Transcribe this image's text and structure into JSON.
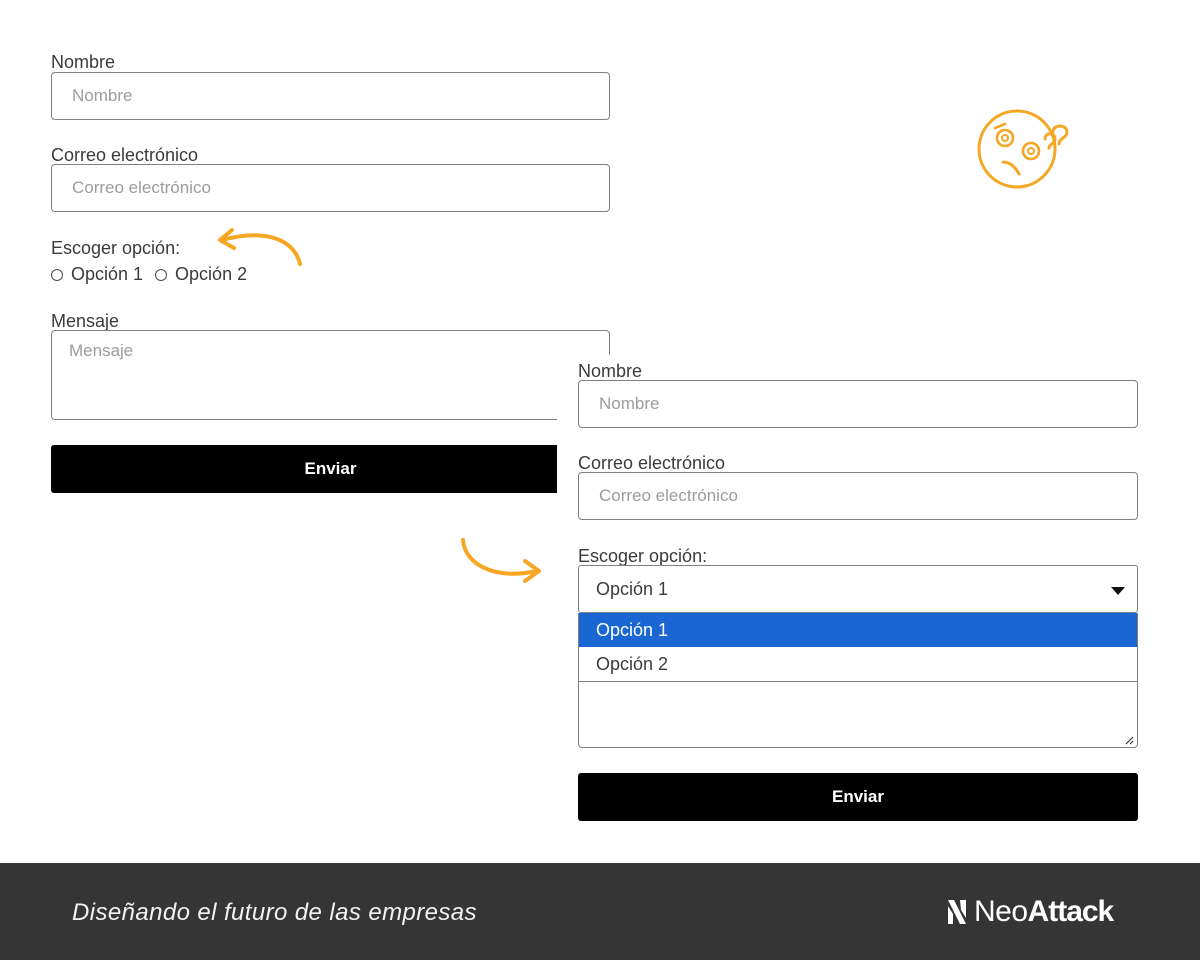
{
  "left_form": {
    "name_label": "Nombre",
    "name_placeholder": "Nombre",
    "email_label": "Correo electrónico",
    "email_placeholder": "Correo electrónico",
    "choice_label": "Escoger opción:",
    "radio_options": [
      "Opción 1",
      "Opción 2"
    ],
    "message_label": "Mensaje",
    "message_placeholder": "Mensaje",
    "submit_label": "Enviar"
  },
  "right_form": {
    "name_label": "Nombre",
    "name_placeholder": "Nombre",
    "email_label": "Correo electrónico",
    "email_placeholder": "Correo electrónico",
    "choice_label": "Escoger opción:",
    "select_value": "Opción 1",
    "dropdown_options": [
      "Opción 1",
      "Opción 2"
    ],
    "dropdown_selected_index": 0,
    "submit_label": "Enviar"
  },
  "footer": {
    "tagline": "Diseñando el futuro de las empresas",
    "brand_neo": "Neo",
    "brand_attack": "Attack"
  },
  "colors": {
    "accent_orange": "#f5a623",
    "select_highlight": "#1a66d2",
    "footer_bg": "#353535",
    "button_bg": "#000000"
  },
  "icons": [
    "confused-face-icon",
    "curved-arrow-icon",
    "caret-down-icon",
    "brand-logo-icon",
    "resize-grip-icon"
  ]
}
